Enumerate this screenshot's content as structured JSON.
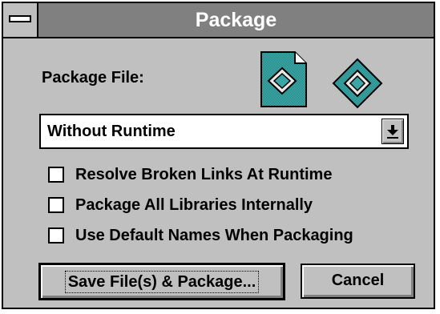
{
  "window": {
    "title": "Package"
  },
  "package_file": {
    "label": "Package File:",
    "icons": [
      "package-file-icon",
      "diamond-icon"
    ],
    "select": {
      "value": "Without Runtime",
      "icon": "dropdown-arrow-icon"
    }
  },
  "options": [
    {
      "label": "Resolve Broken Links At Runtime",
      "checked": false
    },
    {
      "label": "Package All Libraries Internally",
      "checked": false
    },
    {
      "label": "Use Default Names When Packaging",
      "checked": false
    }
  ],
  "buttons": {
    "save": "Save File(s) & Package...",
    "cancel": "Cancel"
  },
  "colors": {
    "face": "#c0c0c0",
    "titlebar": "#808080",
    "icon_teal": "#3aa6a6"
  }
}
